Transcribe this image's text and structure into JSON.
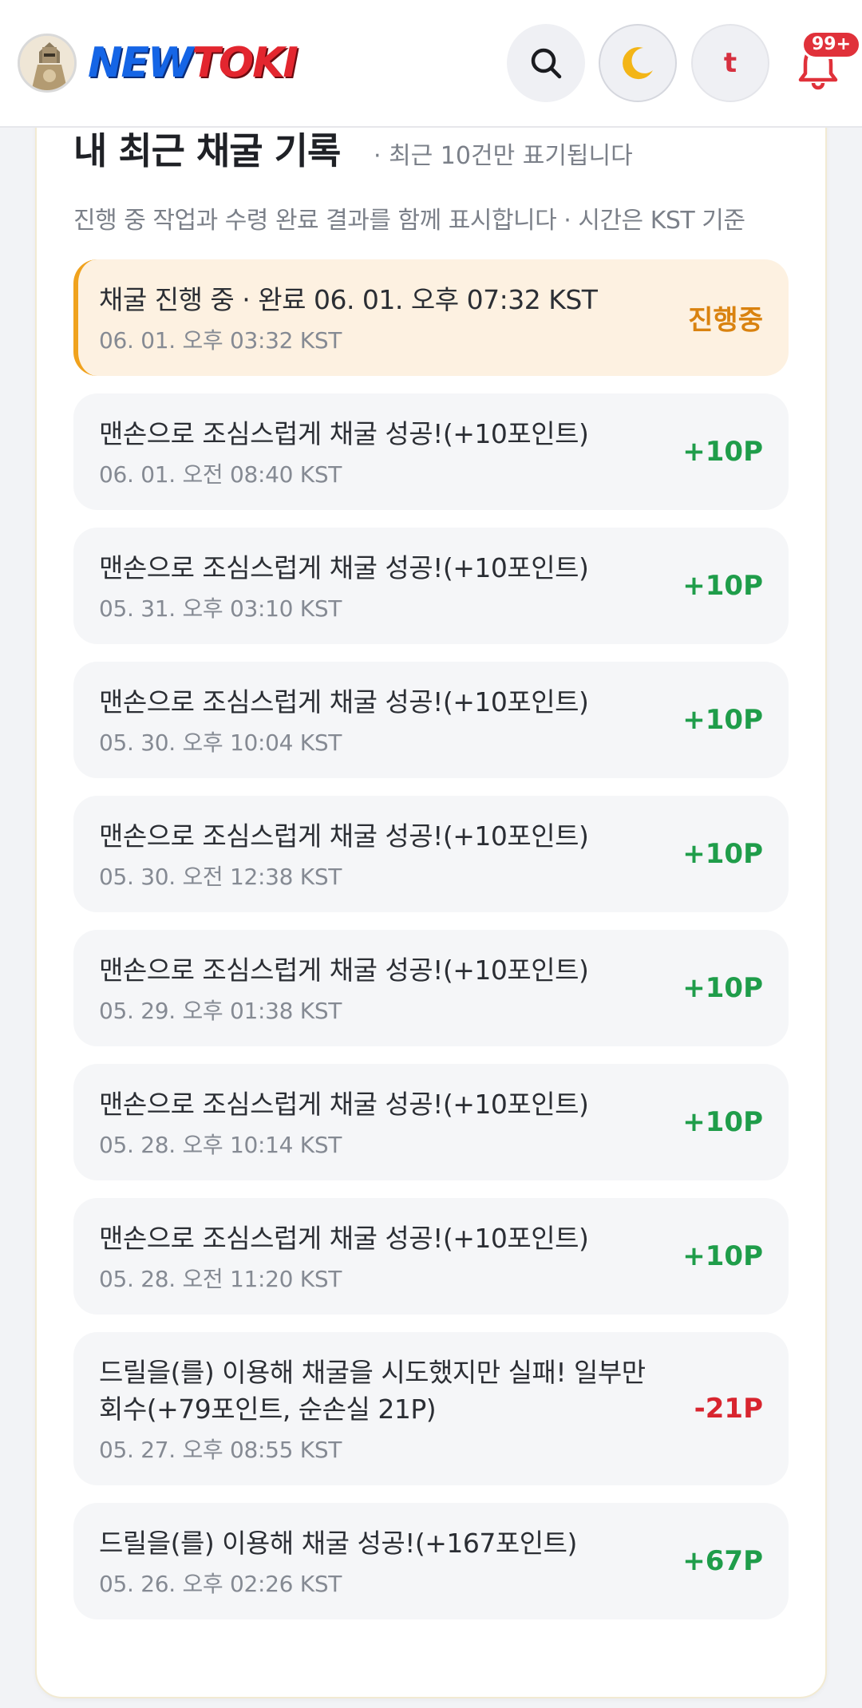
{
  "header": {
    "logo_new": "NEW",
    "logo_toki": "TOKI",
    "user_initial": "t",
    "notification_count": "99+"
  },
  "section": {
    "title": "내 최근 채굴 기록",
    "note": "· 최근 10건만 표기됩니다",
    "subtitle": "진행 중 작업과 수령 완료 결과를 함께 표시합니다 · 시간은 KST 기준"
  },
  "records": [
    {
      "title": "채굴 진행 중 · 완료 06. 01. 오후 07:32 KST",
      "time": "06. 01. 오후 03:32 KST",
      "badge": "진행중",
      "status": "progress"
    },
    {
      "title": "맨손으로 조심스럽게 채굴 성공!(+10포인트)",
      "time": "06. 01. 오전 08:40 KST",
      "badge": "+10P",
      "status": "plus"
    },
    {
      "title": "맨손으로 조심스럽게 채굴 성공!(+10포인트)",
      "time": "05. 31. 오후 03:10 KST",
      "badge": "+10P",
      "status": "plus"
    },
    {
      "title": "맨손으로 조심스럽게 채굴 성공!(+10포인트)",
      "time": "05. 30. 오후 10:04 KST",
      "badge": "+10P",
      "status": "plus"
    },
    {
      "title": "맨손으로 조심스럽게 채굴 성공!(+10포인트)",
      "time": "05. 30. 오전 12:38 KST",
      "badge": "+10P",
      "status": "plus"
    },
    {
      "title": "맨손으로 조심스럽게 채굴 성공!(+10포인트)",
      "time": "05. 29. 오후 01:38 KST",
      "badge": "+10P",
      "status": "plus"
    },
    {
      "title": "맨손으로 조심스럽게 채굴 성공!(+10포인트)",
      "time": "05. 28. 오후 10:14 KST",
      "badge": "+10P",
      "status": "plus"
    },
    {
      "title": "맨손으로 조심스럽게 채굴 성공!(+10포인트)",
      "time": "05. 28. 오전 11:20 KST",
      "badge": "+10P",
      "status": "plus"
    },
    {
      "title": "드릴을(를) 이용해 채굴을 시도했지만 실패! 일부만 회수(+79포인트, 순손실 21P)",
      "time": "05. 27. 오후 08:55 KST",
      "badge": "-21P",
      "status": "minus"
    },
    {
      "title": "드릴을(를) 이용해 채굴 성공!(+167포인트)",
      "time": "05. 26. 오후 02:26 KST",
      "badge": "+67P",
      "status": "plus"
    }
  ],
  "icons": {
    "search": "search-icon",
    "theme": "moon-icon",
    "notifications": "bell-icon",
    "logo": "knight-avatar"
  },
  "colors": {
    "plus": "#1f9d4a",
    "minus": "#d8252f",
    "progress": "#d9820f",
    "progress_bg": "#fdf1e1",
    "accent_border": "#f0a21d"
  }
}
